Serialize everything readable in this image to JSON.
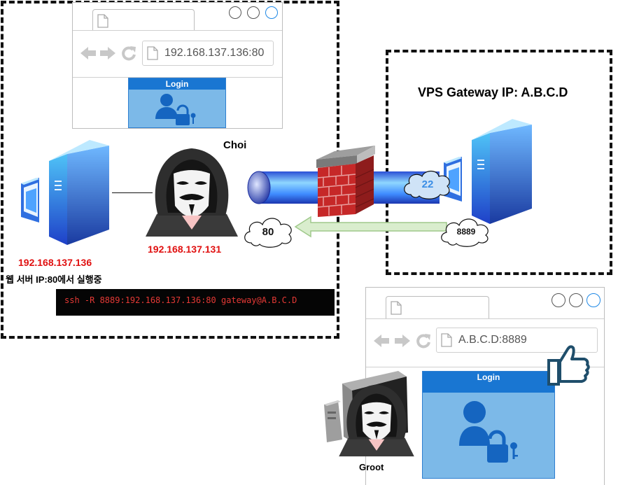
{
  "browser_top": {
    "address": "192.168.137.136:80",
    "login_label": "Login"
  },
  "browser_bottom": {
    "address": "A.B.C.D:8889",
    "login_label": "Login"
  },
  "vps": {
    "title": "VPS Gateway IP: A.B.C.D"
  },
  "attacker": {
    "name": "Choi",
    "ip": "192.168.137.131"
  },
  "web_server": {
    "ip": "192.168.137.136",
    "desc": "웹 서버 IP:80에서 실행중"
  },
  "clouds": {
    "port_ssh": "22",
    "port_local": "80",
    "port_remote": "8889"
  },
  "terminal": {
    "command": "ssh -R 8889:192.168.137.136:80 gateway@A.B.C.D"
  },
  "victim": {
    "name": "Groot"
  },
  "colors": {
    "ip_red": "#e01010",
    "login_blue": "#1976d2",
    "panel_blue": "#7cb9e8",
    "arrow_green": "#cfe8c4"
  }
}
